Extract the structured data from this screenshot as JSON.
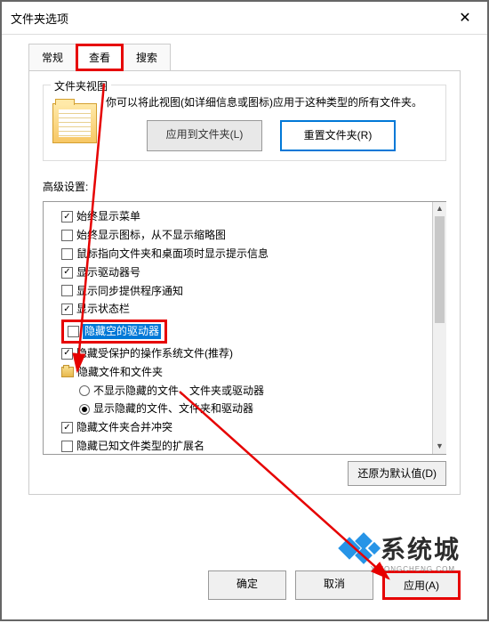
{
  "titlebar": {
    "title": "文件夹选项"
  },
  "tabs": {
    "t0": "常规",
    "t1": "查看",
    "t2": "搜索"
  },
  "folderview": {
    "legend": "文件夹视图",
    "desc": "你可以将此视图(如详细信息或图标)应用于这种类型的所有文件夹。",
    "apply_btn": "应用到文件夹(L)",
    "reset_btn": "重置文件夹(R)"
  },
  "advanced": {
    "label": "高级设置:",
    "items": [
      {
        "type": "check",
        "checked": true,
        "label": "始终显示菜单"
      },
      {
        "type": "check",
        "checked": false,
        "label": "始终显示图标，从不显示缩略图"
      },
      {
        "type": "check",
        "checked": false,
        "label": "鼠标指向文件夹和桌面项时显示提示信息"
      },
      {
        "type": "check",
        "checked": true,
        "label": "显示驱动器号"
      },
      {
        "type": "check",
        "checked": false,
        "label": "显示同步提供程序通知"
      },
      {
        "type": "check",
        "checked": true,
        "label": "显示状态栏"
      },
      {
        "type": "check",
        "checked": false,
        "label": "隐藏空的驱动器",
        "highlight": true
      },
      {
        "type": "check",
        "checked": true,
        "label": "隐藏受保护的操作系统文件(推荐)"
      },
      {
        "type": "folder",
        "label": "隐藏文件和文件夹"
      },
      {
        "type": "radio",
        "checked": false,
        "label": "不显示隐藏的文件、文件夹或驱动器",
        "indent": 1
      },
      {
        "type": "radio",
        "checked": true,
        "label": "显示隐藏的文件、文件夹和驱动器",
        "indent": 1
      },
      {
        "type": "check",
        "checked": true,
        "label": "隐藏文件夹合并冲突"
      },
      {
        "type": "check",
        "checked": false,
        "label": "隐藏已知文件类型的扩展名"
      }
    ],
    "restore_btn": "还原为默认值(D)"
  },
  "buttons": {
    "ok": "确定",
    "cancel": "取消",
    "apply": "应用(A)"
  },
  "watermark": {
    "text": "系统城",
    "sub": "XITONGCHENG.COM"
  }
}
